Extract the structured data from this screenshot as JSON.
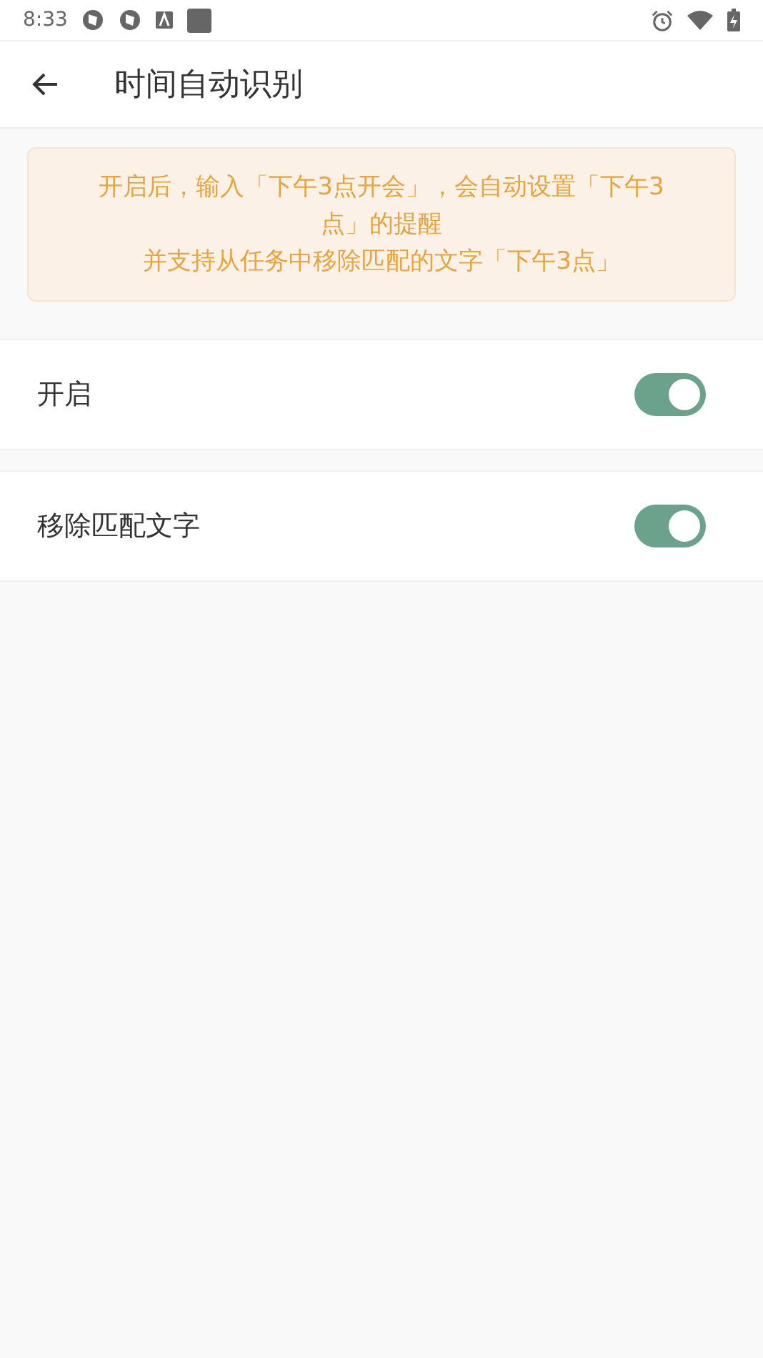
{
  "status_bar": {
    "time": "8:33"
  },
  "app_bar": {
    "title": "时间自动识别"
  },
  "notice": {
    "lines": [
      "开启后，输入「下午3点开会」，会自动设置「下午3点」的提醒",
      "并支持从任务中移除匹配的文字「下午3点」"
    ]
  },
  "settings": [
    {
      "label": "开启",
      "on": true
    },
    {
      "label": "移除匹配文字",
      "on": true
    }
  ]
}
